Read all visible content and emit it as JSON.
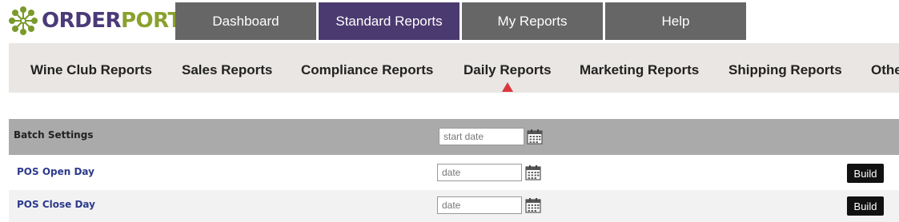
{
  "logo": {
    "part1": "ORDER",
    "part2": "PORT",
    "colors": {
      "order": "#4b3a78",
      "port": "#8aa12e"
    }
  },
  "top_nav": {
    "tabs": [
      {
        "label": "Dashboard",
        "active": false
      },
      {
        "label": "Standard Reports",
        "active": true
      },
      {
        "label": "My Reports",
        "active": false
      },
      {
        "label": "Help",
        "active": false
      }
    ],
    "active_color": "#4b3a70",
    "inactive_color": "#666666"
  },
  "sub_nav": {
    "items": [
      {
        "label": "Wine Club Reports"
      },
      {
        "label": "Sales Reports"
      },
      {
        "label": "Compliance Reports"
      },
      {
        "label": "Daily Reports",
        "active": true
      },
      {
        "label": "Marketing Reports"
      },
      {
        "label": "Shipping Reports"
      },
      {
        "label": "Othe"
      }
    ],
    "indicator_color": "#d9363e"
  },
  "batch": {
    "title": "Batch Settings",
    "start_date_placeholder": "start date",
    "calendar_icon": "calendar-icon"
  },
  "reports": [
    {
      "name": "POS Open Day",
      "date_placeholder": "date",
      "build_label": "Build"
    },
    {
      "name": "POS Close Day",
      "date_placeholder": "date",
      "build_label": "Build"
    }
  ]
}
